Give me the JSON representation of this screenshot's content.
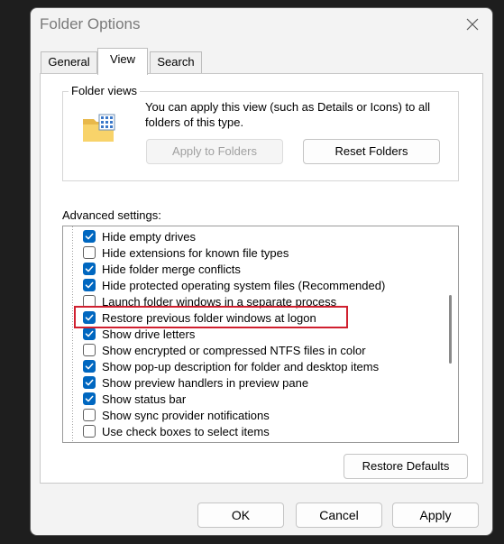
{
  "window": {
    "title": "Folder Options"
  },
  "tabs": [
    {
      "label": "General",
      "active": false
    },
    {
      "label": "View",
      "active": true
    },
    {
      "label": "Search",
      "active": false
    }
  ],
  "folder_views": {
    "legend": "Folder views",
    "description": "You can apply this view (such as Details or Icons) to all folders of this type.",
    "apply_button": "Apply to Folders",
    "apply_button_enabled": false,
    "reset_button": "Reset Folders"
  },
  "advanced": {
    "label": "Advanced settings:",
    "items": [
      {
        "label": "Hide empty drives",
        "checked": true
      },
      {
        "label": "Hide extensions for known file types",
        "checked": false
      },
      {
        "label": "Hide folder merge conflicts",
        "checked": true
      },
      {
        "label": "Hide protected operating system files (Recommended)",
        "checked": true
      },
      {
        "label": "Launch folder windows in a separate process",
        "checked": false
      },
      {
        "label": "Restore previous folder windows at logon",
        "checked": true,
        "highlighted": true
      },
      {
        "label": "Show drive letters",
        "checked": true
      },
      {
        "label": "Show encrypted or compressed NTFS files in color",
        "checked": false
      },
      {
        "label": "Show pop-up description for folder and desktop items",
        "checked": true
      },
      {
        "label": "Show preview handlers in preview pane",
        "checked": true
      },
      {
        "label": "Show status bar",
        "checked": true
      },
      {
        "label": "Show sync provider notifications",
        "checked": false
      },
      {
        "label": "Use check boxes to select items",
        "checked": false
      }
    ],
    "restore_defaults_button": "Restore Defaults"
  },
  "footer": {
    "ok": "OK",
    "cancel": "Cancel",
    "apply": "Apply"
  },
  "colors": {
    "accent": "#0067c0",
    "highlight_box": "#d0202f"
  },
  "icons": {
    "close": "close-icon",
    "folder": "folder-icon",
    "check": "check-icon"
  }
}
